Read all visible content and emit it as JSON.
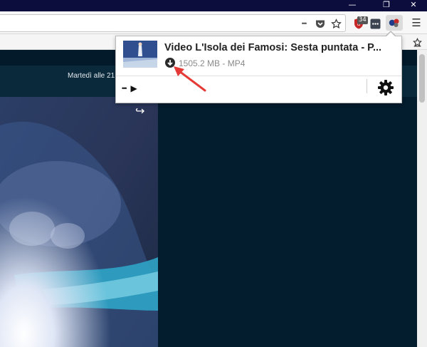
{
  "window": {
    "minimize_glyph": "—",
    "restore_glyph": "❐",
    "close_glyph": "✕"
  },
  "toolbar": {
    "page_actions_glyph": "•••",
    "ublock_badge": "34",
    "menu_glyph": "☰"
  },
  "page": {
    "schedule_text": "Martedì alle 21",
    "share_glyph": "↪"
  },
  "popup": {
    "video_title": "Video L'Isola dei Famosi: Sesta puntata - P...",
    "file_size": "1505.2 MB",
    "separator": " - ",
    "format": "MP4",
    "more_glyph": "•••",
    "play_glyph": "▶"
  },
  "colors": {
    "titlebar": "#0c0c3d",
    "page_bg": "#031a2b",
    "annotation_arrow": "#e53935",
    "ublock_red": "#c62828"
  },
  "icons": [
    "pocket-icon",
    "bookmark-star-icon",
    "ublock-origin-icon",
    "extension-icon",
    "video-downloader-icon",
    "hamburger-menu-icon",
    "download-icon",
    "gear-icon",
    "share-icon"
  ]
}
